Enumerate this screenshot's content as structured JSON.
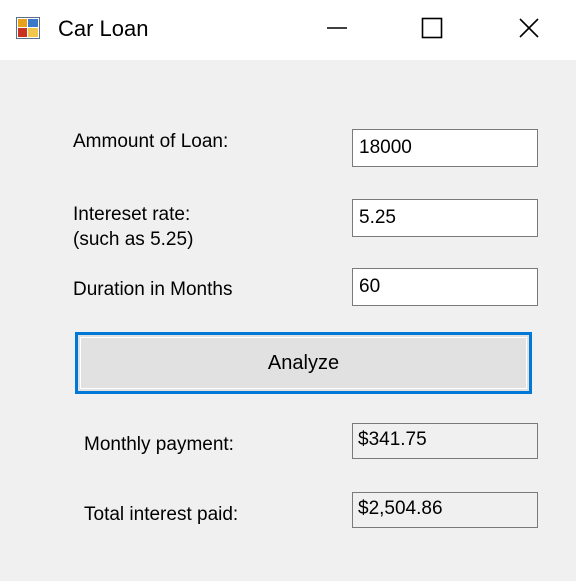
{
  "window": {
    "title": "Car Loan",
    "icon": "form-app-icon",
    "controls": {
      "minimize_icon": "minimize-icon",
      "maximize_icon": "maximize-icon",
      "close_icon": "close-icon"
    }
  },
  "form": {
    "loan_amount": {
      "label": "Ammount of Loan:",
      "value": "18000"
    },
    "interest_rate": {
      "label_line1": "Intereset rate:",
      "label_line2": "(such as 5.25)",
      "value": "5.25"
    },
    "duration": {
      "label": "Duration in Months",
      "value": "60"
    },
    "analyze_button": {
      "label": "Analyze"
    },
    "monthly_payment": {
      "label": "Monthly payment:",
      "value": "$341.75"
    },
    "total_interest": {
      "label": "Total interest paid:",
      "value": "$2,504.86"
    }
  },
  "colors": {
    "window_bg": "#f0f0f0",
    "titlebar_bg": "#ffffff",
    "button_focus_border": "#0078d7",
    "button_bg": "#e1e1e1"
  }
}
